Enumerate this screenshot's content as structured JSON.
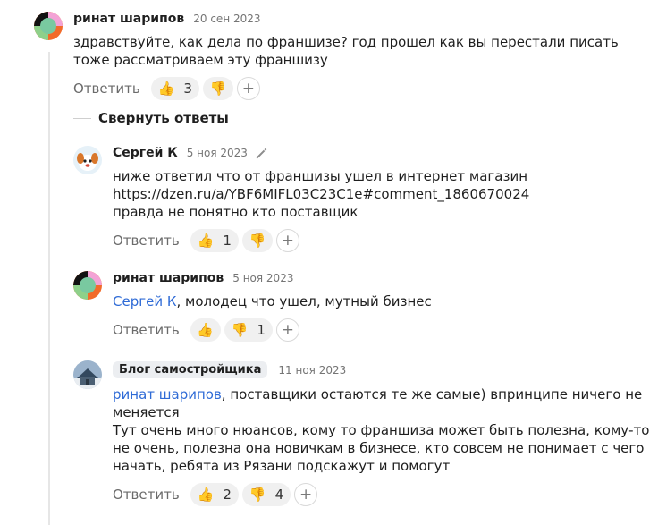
{
  "collapse_label": "Свернуть ответы",
  "reply_label": "Ответить",
  "icons": {
    "like": "thumbs-up-icon",
    "dislike": "thumbs-down-icon",
    "add": "plus-icon",
    "edit": "pencil-icon"
  },
  "comments": [
    {
      "author": "ринат шарипов",
      "date": "20 сен 2023",
      "lines": [
        "здравствуйте, как дела по франшизе? год прошел как вы перестали писать",
        "тоже рассматриваем эту франшизу"
      ],
      "likes": "3",
      "dislikes": ""
    },
    {
      "author": "Сергей К",
      "date": "5 ноя 2023",
      "lines": [
        "ниже ответил что от франшизы ушел в интернет магазин",
        "https://dzen.ru/a/YBF6MIFL03C23C1e#comment_1860670024",
        "правда не понятно кто поставщик"
      ],
      "likes": "1",
      "dislikes": ""
    },
    {
      "author": "ринат шарипов",
      "date": "5 ноя 2023",
      "mention": "Сергей К",
      "lines": [
        ", молодец что ушел, мутный бизнес"
      ],
      "likes": "",
      "dislikes": "1"
    },
    {
      "author": "Блог самостройщика",
      "date": "11 ноя 2023",
      "mention": "ринат шарипов",
      "lines": [
        ", поставщики остаются те же самые) впринципе ничего не",
        "меняется",
        "Тут очень много нюансов, кому то франшиза может быть полезна, кому-то",
        "не очень, полезна она новичкам в бизнесе, кто совсем не понимает с чего",
        "начать, ребята из Рязани подскажут и помогут"
      ],
      "likes": "2",
      "dislikes": "4"
    }
  ]
}
